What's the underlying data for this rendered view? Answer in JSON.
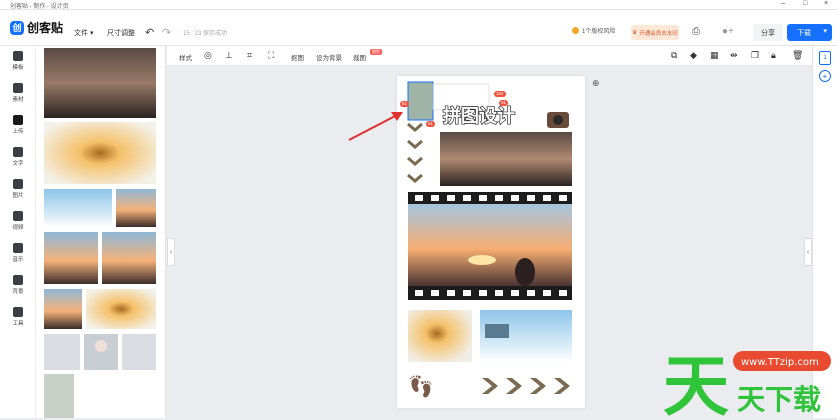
{
  "window": {
    "title": "创客贴 - 制作 - 设计页"
  },
  "app": {
    "logo_mark": "创",
    "logo_text": "创客贴"
  },
  "topbar": {
    "file_menu": "文件 ▾",
    "resize_menu": "尺寸调整",
    "saved_status": "15 : 23 保存成功",
    "risk_text": "1个版权风险",
    "vip_text": "开通会员去水印",
    "share_label": "分享",
    "download_label": "下载"
  },
  "toolbar": {
    "style": "样式",
    "cutout": "抠图",
    "set_bg": "设为背景",
    "crop": "裁图",
    "new_badge": "限免"
  },
  "leftnav": [
    {
      "label": "模板",
      "name": "nav-template"
    },
    {
      "label": "素材",
      "name": "nav-material"
    },
    {
      "label": "上传",
      "name": "nav-upload"
    },
    {
      "label": "文字",
      "name": "nav-text"
    },
    {
      "label": "图片",
      "name": "nav-image"
    },
    {
      "label": "视频",
      "name": "nav-video"
    },
    {
      "label": "音乐",
      "name": "nav-music"
    },
    {
      "label": "背景",
      "name": "nav-background"
    },
    {
      "label": "工具",
      "name": "nav-tools"
    }
  ],
  "canvas": {
    "title": "拼图设计",
    "badge_size_w": "104",
    "badge_size_h": "51",
    "badge_a": "91",
    "badge_b": "91"
  },
  "right_rail": {
    "page_number": "1"
  },
  "watermark": {
    "brand": "www.TTzip.com",
    "text": "天下载",
    "big": "天"
  },
  "colors": {
    "accent": "#1570ff",
    "arrow": "#e03030",
    "chevron": "#7a6a4f"
  }
}
